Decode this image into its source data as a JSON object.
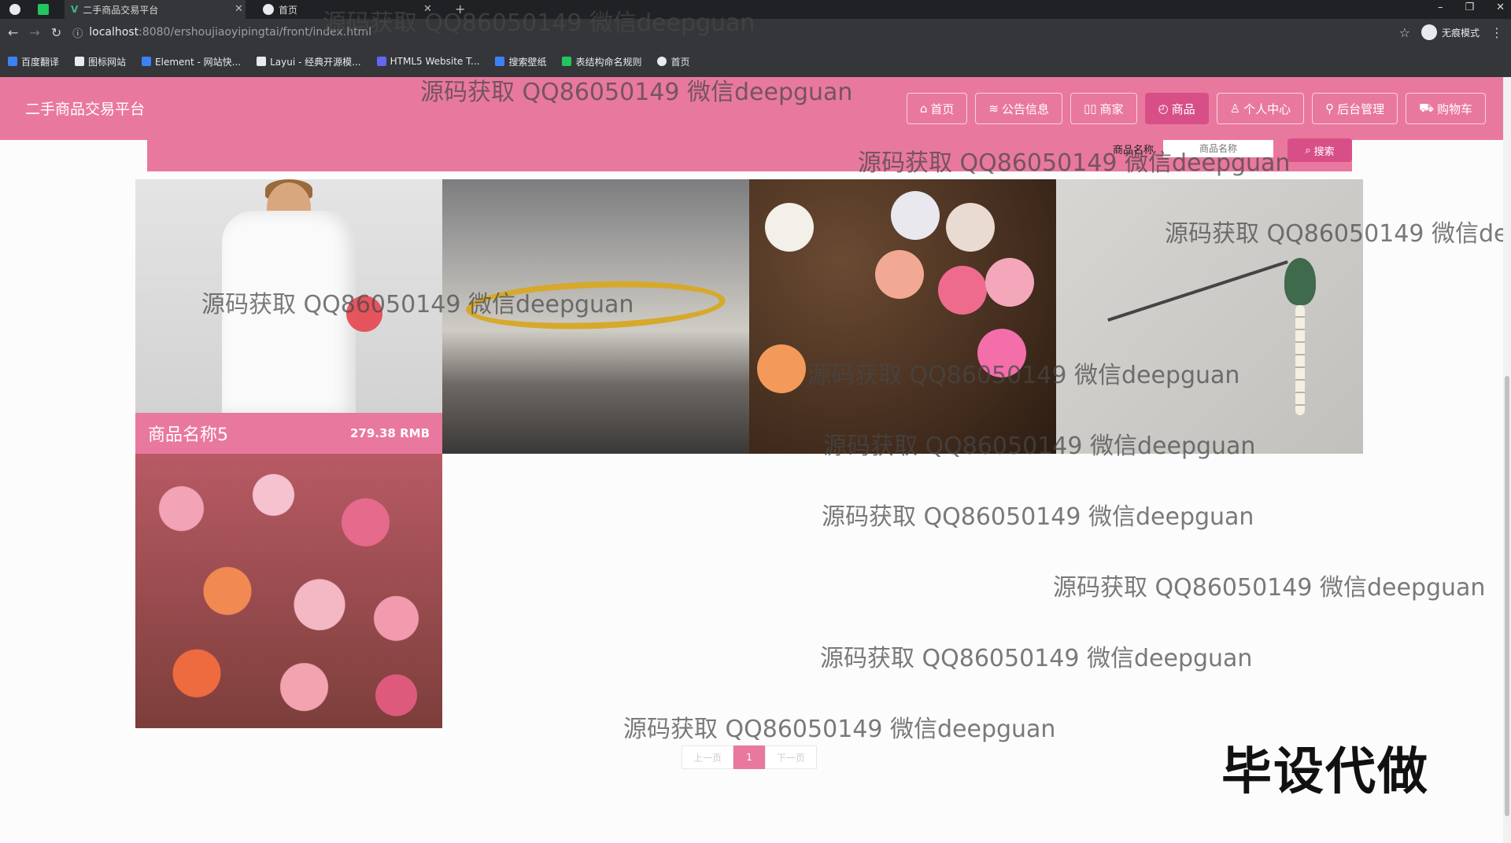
{
  "browser": {
    "tabs": [
      {
        "title": "二手商品交易平台"
      },
      {
        "title": "首页"
      }
    ],
    "new_tab_icon": "plus-icon",
    "url_host": "localhost",
    "url_path": ":8080/ershoujiaoyipingtai/front/index.html",
    "incognito_label": "无痕模式",
    "bookmarks": [
      {
        "label": "百度翻译",
        "color": "#3b82f6"
      },
      {
        "label": "图标网站",
        "color": "#e8eaed"
      },
      {
        "label": "Element - 网站快...",
        "color": "#3b82f6"
      },
      {
        "label": "Layui - 经典开源模...",
        "color": "#e8eaed"
      },
      {
        "label": "HTML5 Website T...",
        "color": "#6366f1"
      },
      {
        "label": "搜索壁纸",
        "color": "#3b82f6"
      },
      {
        "label": "表结构命名规则",
        "color": "#22c55e"
      },
      {
        "label": "首页",
        "color": "#e8eaed"
      }
    ]
  },
  "header": {
    "brand": "二手商品交易平台",
    "nav": [
      {
        "label": "首页",
        "icon": "home-icon",
        "glyph": "⌂"
      },
      {
        "label": "公告信息",
        "icon": "bulletin-icon",
        "glyph": "≋"
      },
      {
        "label": "商家",
        "icon": "shop-icon",
        "glyph": "▯▯"
      },
      {
        "label": "商品",
        "icon": "product-icon",
        "glyph": "◴"
      },
      {
        "label": "个人中心",
        "icon": "user-icon",
        "glyph": "♙"
      },
      {
        "label": "后台管理",
        "icon": "link-icon",
        "glyph": "⚲"
      },
      {
        "label": "购物车",
        "icon": "cart-icon",
        "glyph": "⛟"
      }
    ],
    "active_nav": "商品"
  },
  "search": {
    "label": "商品名称",
    "placeholder": "商品名称",
    "button": "搜索"
  },
  "products": [
    {
      "name": "商品名称5",
      "price": "279.38 RMB",
      "image": "white-shirt",
      "hovered": true
    },
    {
      "name": "",
      "price": "",
      "image": "gold-chain"
    },
    {
      "name": "",
      "price": "",
      "image": "makeup-set"
    },
    {
      "name": "",
      "price": "",
      "image": "hairpin"
    },
    {
      "name": "",
      "price": "",
      "image": "flowers"
    }
  ],
  "pager": {
    "prev": "上一页",
    "current": "1",
    "next": "下一页"
  },
  "overlay": {
    "watermark": "源码获取 QQ86050149 微信deepguan",
    "stamp": "毕设代做"
  },
  "colors": {
    "brand_pink": "#e9789f",
    "active_pink": "#d84f87"
  }
}
